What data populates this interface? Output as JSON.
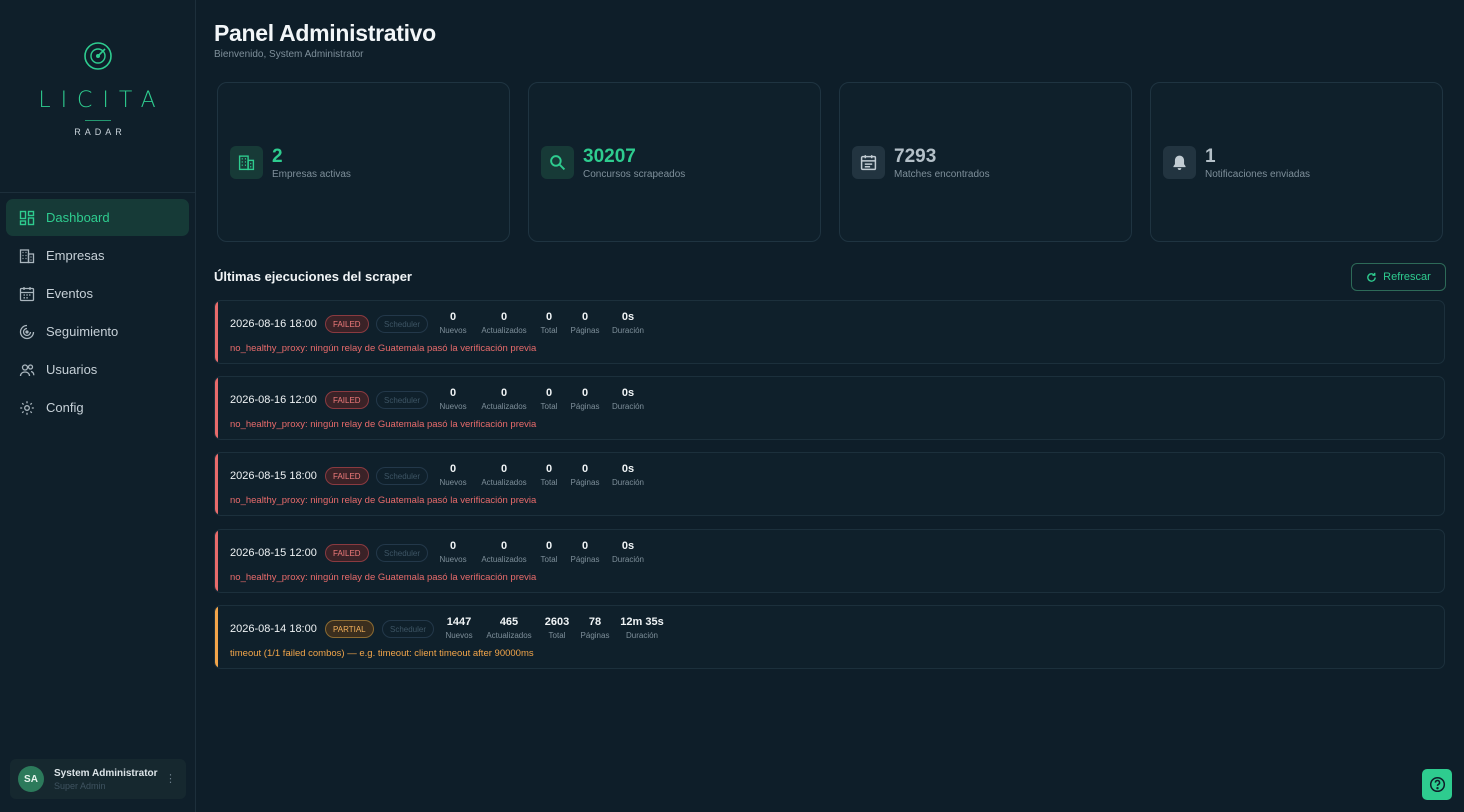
{
  "brand": {
    "name": "LICITA",
    "tagline": "RADAR",
    "accent": "#2ecc8f"
  },
  "nav": {
    "items": [
      {
        "label": "Dashboard",
        "icon": "dashboard-icon",
        "active": true
      },
      {
        "label": "Empresas",
        "icon": "building-icon"
      },
      {
        "label": "Eventos",
        "icon": "calendar-icon"
      },
      {
        "label": "Seguimiento",
        "icon": "radar-icon"
      },
      {
        "label": "Usuarios",
        "icon": "users-icon"
      },
      {
        "label": "Config",
        "icon": "gear-icon"
      }
    ]
  },
  "user": {
    "initials": "SA",
    "name": "System Administrator",
    "role": "Super Admin"
  },
  "header": {
    "title": "Panel Administrativo",
    "subtitle": "Bienvenido, System Administrator"
  },
  "stats": [
    {
      "value": "2",
      "label": "Empresas activas",
      "icon": "building-icon",
      "color": "#2ecc8f"
    },
    {
      "value": "30207",
      "label": "Concursos scrapeados",
      "icon": "search-icon",
      "color": "#2ecc8f"
    },
    {
      "value": "7293",
      "label": "Matches encontrados",
      "icon": "calendar-icon",
      "color": "#b4c0c8"
    },
    {
      "value": "1",
      "label": "Notificaciones enviadas",
      "icon": "bell-icon",
      "color": "#b4c0c8"
    }
  ],
  "runs_section": {
    "title": "Últimas ejecuciones del scraper",
    "refresh_label": "Refrescar"
  },
  "stat_labels": {
    "new": "Nuevos",
    "updated": "Actualizados",
    "total": "Total",
    "pages": "Páginas",
    "duration": "Duración"
  },
  "runs": [
    {
      "date": "2026-08-16 18:00",
      "status": "FAILED",
      "trigger": "Scheduler",
      "new": "0",
      "updated": "0",
      "total": "0",
      "pages": "0",
      "duration": "0s",
      "message": "no_healthy_proxy: ningún relay de Guatemala pasó la verificación previa"
    },
    {
      "date": "2026-08-16 12:00",
      "status": "FAILED",
      "trigger": "Scheduler",
      "new": "0",
      "updated": "0",
      "total": "0",
      "pages": "0",
      "duration": "0s",
      "message": "no_healthy_proxy: ningún relay de Guatemala pasó la verificación previa"
    },
    {
      "date": "2026-08-15 18:00",
      "status": "FAILED",
      "trigger": "Scheduler",
      "new": "0",
      "updated": "0",
      "total": "0",
      "pages": "0",
      "duration": "0s",
      "message": "no_healthy_proxy: ningún relay de Guatemala pasó la verificación previa"
    },
    {
      "date": "2026-08-15 12:00",
      "status": "FAILED",
      "trigger": "Scheduler",
      "new": "0",
      "updated": "0",
      "total": "0",
      "pages": "0",
      "duration": "0s",
      "message": "no_healthy_proxy: ningún relay de Guatemala pasó la verificación previa"
    },
    {
      "date": "2026-08-14 18:00",
      "status": "PARTIAL",
      "trigger": "Scheduler",
      "new": "1447",
      "updated": "465",
      "total": "2603",
      "pages": "78",
      "duration": "12m 35s",
      "message": "timeout (1/1 failed combos) — e.g. timeout: client timeout after 90000ms"
    }
  ],
  "colors": {
    "failed": "#e86b6b",
    "partial": "#f2a54a",
    "background": "#0e1e29"
  }
}
